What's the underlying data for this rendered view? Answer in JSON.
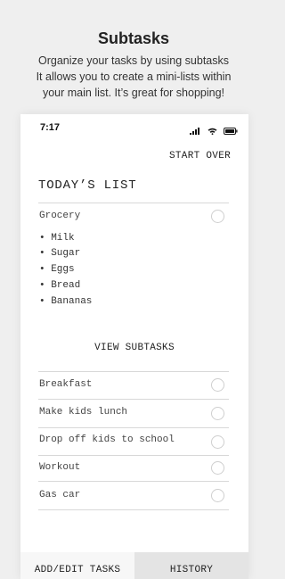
{
  "promo": {
    "title": "Subtasks",
    "lines": [
      "Organize your tasks by using subtasks",
      "It allows you to create a mini-lists within",
      "your main list. It’s great for shopping!"
    ]
  },
  "status_bar": {
    "time": "7:17",
    "icons": [
      "signal-icon",
      "wifi-icon",
      "battery-icon"
    ]
  },
  "header": {
    "start_over_label": "START OVER"
  },
  "list": {
    "title": "TODAY’S LIST",
    "main_task": "Grocery",
    "subtasks": [
      "• Milk",
      "• Sugar",
      "• Eggs",
      "• Bread",
      "• Bananas"
    ],
    "view_subtasks_label": "VIEW SUBTASKS",
    "tasks": [
      "Breakfast",
      "Make kids lunch",
      "Drop off kids to school",
      "Workout",
      "Gas car"
    ]
  },
  "tabs": {
    "add_edit_label": "ADD/EDIT TASKS",
    "history_label": "HISTORY"
  }
}
